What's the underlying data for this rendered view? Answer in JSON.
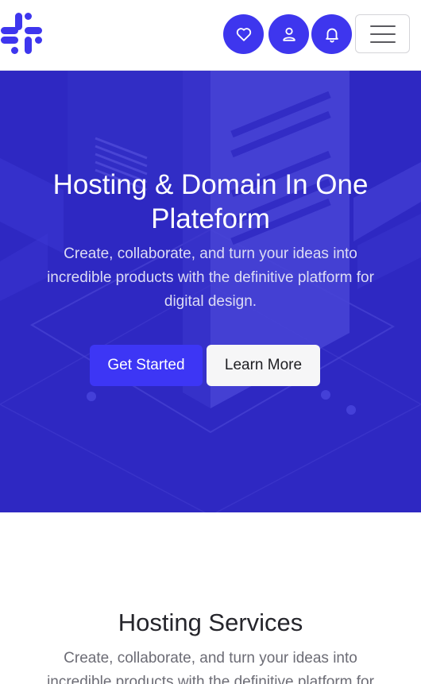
{
  "header": {
    "logo": "slack-style-logo-icon",
    "icons": [
      "heart-icon",
      "user-icon",
      "bell-icon"
    ],
    "menu_icon": "hamburger-icon",
    "accent_color": "#3e36ee"
  },
  "hero": {
    "title_line1": "Hosting & Domain In One",
    "title_line2": "Plateform",
    "subtitle": "Create, collaborate, and turn your ideas into incredible products with the definitive platform for digital design.",
    "primary_button": "Get Started",
    "secondary_button": "Learn More",
    "background_color": "#2e28c2"
  },
  "services": {
    "title": "Hosting Services",
    "subtitle": "Create, collaborate, and turn your ideas into incredible products with the definitive platform for digital design."
  }
}
